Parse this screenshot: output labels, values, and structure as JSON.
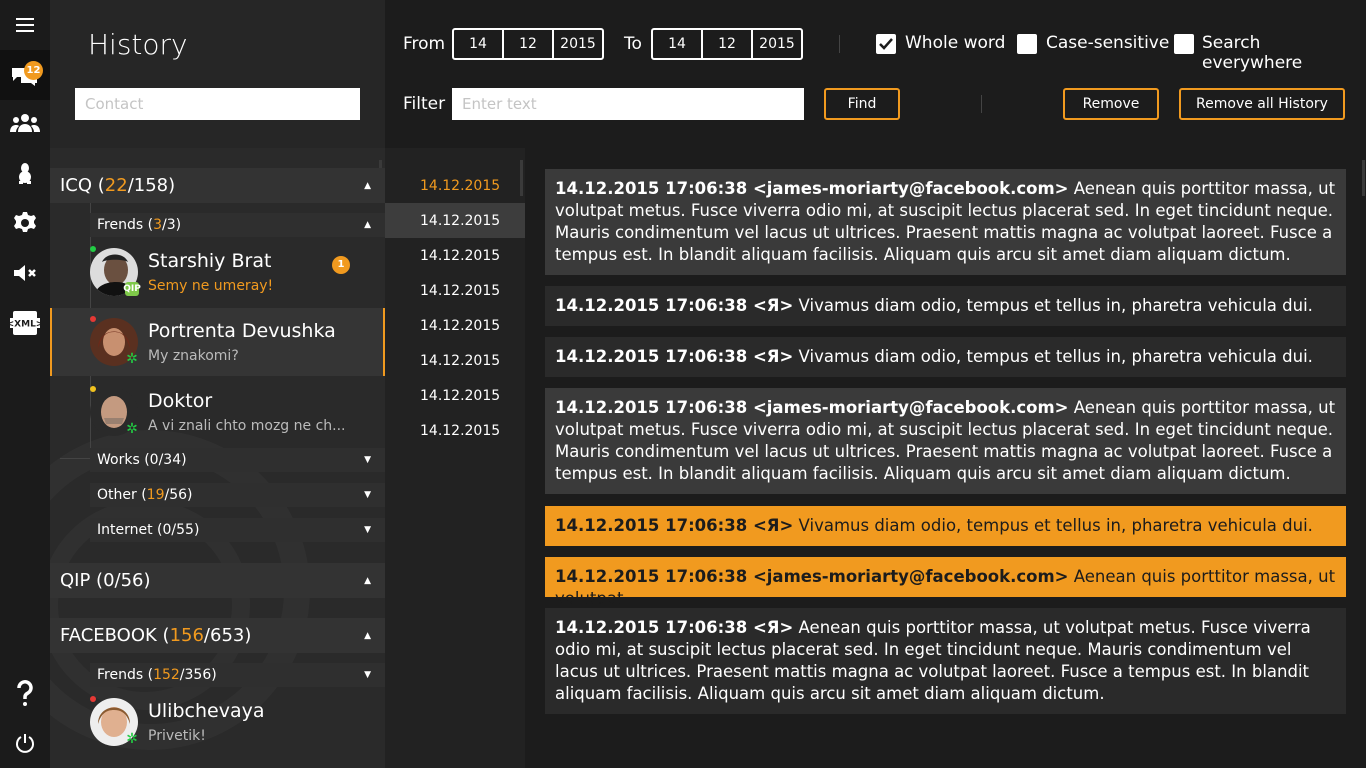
{
  "app": {
    "title": "History"
  },
  "rail": {
    "notif_count": "12"
  },
  "contact_search": {
    "placeholder": "Contact"
  },
  "accounts": {
    "icq": {
      "name": "ICQ (",
      "online": "22",
      "total": "/158)"
    },
    "qip": {
      "label": "QIP (0/56)"
    },
    "facebook": {
      "name": "FACEBOOK (",
      "online": "156",
      "total": "/653)"
    }
  },
  "groups": {
    "icq_frends": {
      "name": "Frends (",
      "online": "3",
      "total": "/3)"
    },
    "works": {
      "label": "Works (0/34)"
    },
    "other": {
      "name": "Other (",
      "online": "19",
      "total": "/56)"
    },
    "internet": {
      "label": "Internet (0/55)"
    },
    "fb_frends": {
      "name": "Frends (",
      "online": "152",
      "total": "/356)"
    }
  },
  "contacts": [
    {
      "name": "Starshiy Brat",
      "status": "Semy ne umeray!",
      "badge": "1",
      "proto": "QIP"
    },
    {
      "name": "Portrenta Devushka",
      "status": "My znakomi?"
    },
    {
      "name": "Doktor",
      "status": "A vi znali chto mozg ne ch..."
    },
    {
      "name": "Ulibchevaya",
      "status": "Privetik!"
    }
  ],
  "toolbar": {
    "from_label": "From",
    "to_label": "To",
    "from": {
      "day": "14",
      "month": "12",
      "year": "2015"
    },
    "to": {
      "day": "14",
      "month": "12",
      "year": "2015"
    },
    "whole_word": "Whole word",
    "case_sensitive": "Case-sensitive",
    "search_everywhere": "Search everywhere",
    "filter_label": "Filter",
    "filter_placeholder": "Enter text",
    "find": "Find",
    "remove": "Remove",
    "remove_all": "Remove all History"
  },
  "options": {
    "whole_word": true,
    "case_sensitive": false,
    "search_everywhere": false
  },
  "dates": [
    "14.12.2015",
    "14.12.2015",
    "14.12.2015",
    "14.12.2015",
    "14.12.2015",
    "14.12.2015",
    "14.12.2015",
    "14.12.2015"
  ],
  "messages": [
    {
      "head": "14.12.2015 17:06:38 <james-moriarty@facebook.com>",
      "text": " Aenean quis porttitor massa, ut volutpat metus. Fusce viverra odio mi, at suscipit lectus placerat sed. In eget tincidunt neque. Mauris condimentum vel lacus ut ultrices. Praesent mattis magna ac volutpat laoreet. Fusce a tempus est. In blandit aliquam facilisis. Aliquam quis arcu sit amet diam aliquam dictum."
    },
    {
      "head": "14.12.2015 17:06:38 <Я>",
      "text": " Vivamus diam odio, tempus et tellus in, pharetra vehicula dui."
    },
    {
      "head": "14.12.2015 17:06:38 <Я>",
      "text": " Vivamus diam odio, tempus et tellus in, pharetra vehicula dui."
    },
    {
      "head": "14.12.2015 17:06:38 <james-moriarty@facebook.com>",
      "text": " Aenean quis porttitor massa, ut volutpat metus. Fusce viverra odio mi, at suscipit lectus placerat sed. In eget tincidunt neque. Mauris condimentum vel lacus ut ultrices. Praesent mattis magna ac volutpat laoreet. Fusce a tempus est. In blandit aliquam facilisis. Aliquam quis arcu sit amet diam aliquam dictum."
    },
    {
      "head": "14.12.2015 17:06:38 <Я>",
      "text": " Vivamus diam odio, tempus et tellus in, pharetra vehicula dui."
    },
    {
      "head": "14.12.2015 17:06:38 <james-moriarty@facebook.com>",
      "text": " Aenean quis porttitor massa, ut volutpat"
    },
    {
      "head": "14.12.2015 17:06:38 <Я>",
      "text": " Aenean quis porttitor massa, ut volutpat metus. Fusce viverra odio mi, at suscipit lectus placerat sed. In eget tincidunt neque. Mauris condimentum vel lacus ut ultrices. Praesent mattis magna ac volutpat laoreet. Fusce a tempus est. In blandit aliquam facilisis. Aliquam quis arcu sit amet diam aliquam dictum."
    }
  ],
  "colors": {
    "accent": "#f19a1f",
    "background": "#1c1c1c",
    "panel": "#2a2a2a",
    "online": "#22cc44",
    "busy": "#e53935",
    "away": "#f1c21f"
  }
}
